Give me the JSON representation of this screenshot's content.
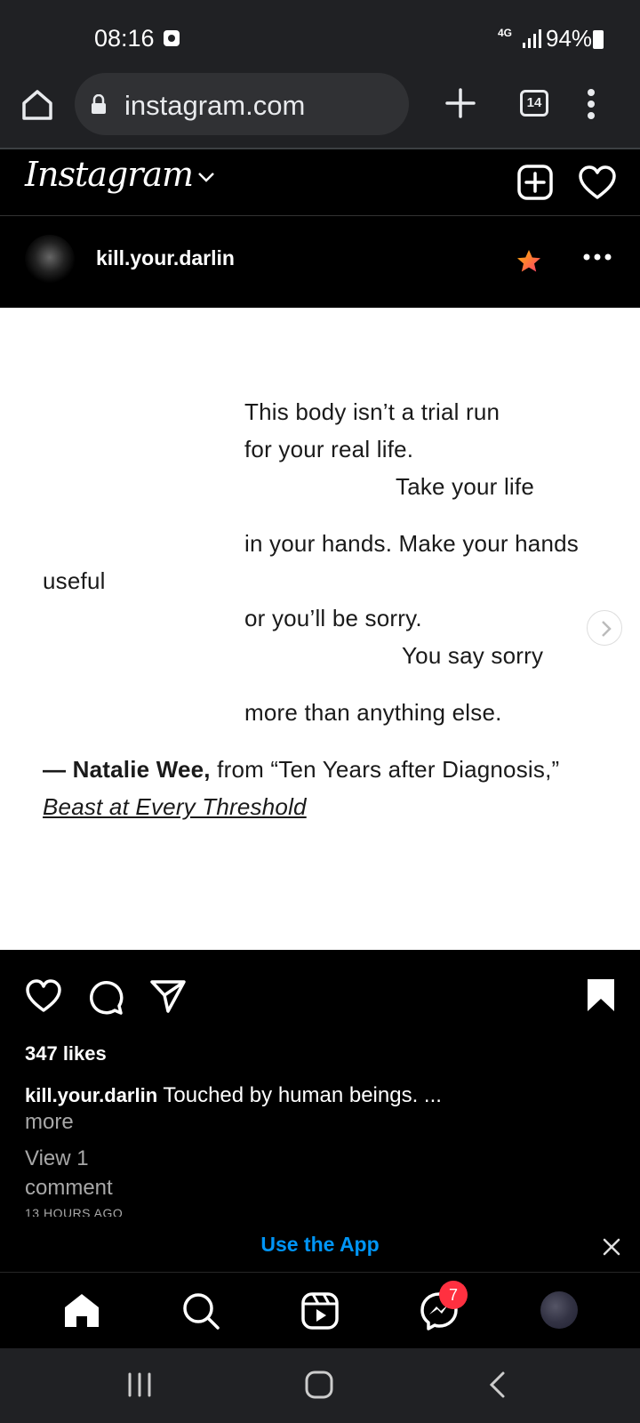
{
  "status_bar": {
    "time": "08:16",
    "network": "4G",
    "battery": "94%"
  },
  "browser": {
    "url": "instagram.com",
    "tab_count": "14"
  },
  "header": {
    "logo": "Instagram"
  },
  "post": {
    "username": "kill.your.darlin",
    "poem_lines": [
      "This body isn’t a trial run",
      "for your real life.",
      "Take your life",
      "in your hands. Make your hands",
      "useful",
      "or you’ll be sorry.",
      "You say sorry",
      "more than anything else."
    ],
    "attribution_dash": "— ",
    "attribution_author": "Natalie Wee,",
    "attribution_from": " from “Ten Years after Diagnosis,”",
    "book_title": "Beast at Every Threshold",
    "likes": "347 likes",
    "caption_user": "kill.your.darlin",
    "caption_text": " Touched by human beings. ...",
    "more_label": "more",
    "view_comments": "View 1 comment",
    "timestamp": "13 HOURS AGO"
  },
  "banner": {
    "use_app": "Use the App"
  },
  "bottom_nav": {
    "messages_badge": "7"
  },
  "colors": {
    "link_blue": "#0095f6",
    "badge_red": "#ff3040",
    "status_bg": "#202124"
  }
}
